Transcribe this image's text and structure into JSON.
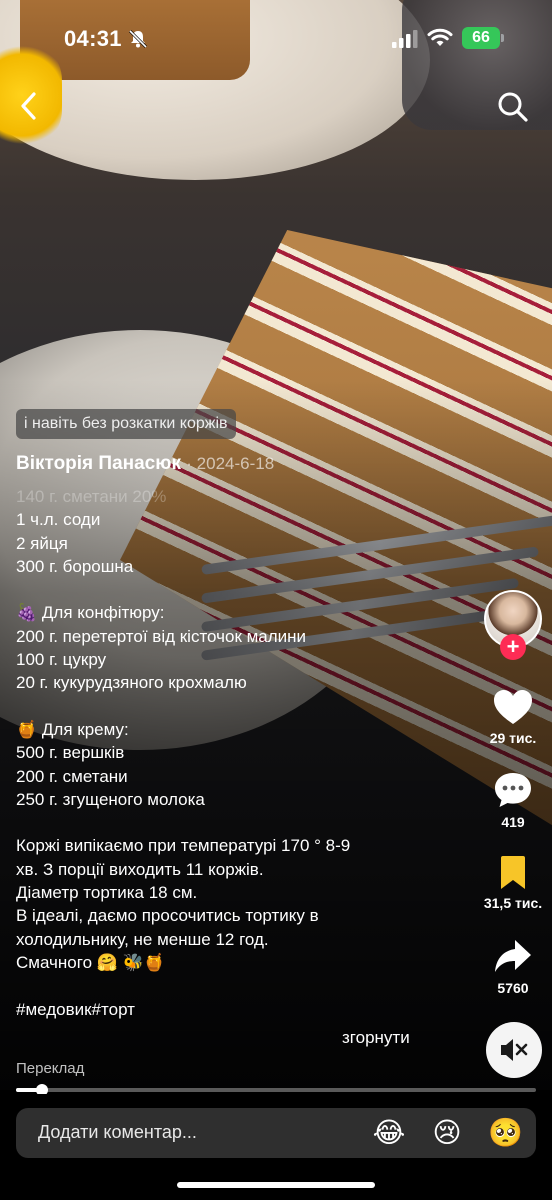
{
  "status_bar": {
    "time": "04:31",
    "battery": "66"
  },
  "caption": {
    "highlight_pill": "і навіть без розкатки коржів",
    "author": "Вікторія Панасюк",
    "date": "2024-6-18",
    "lines": [
      {
        "text": "140 г. сметани 20%",
        "faded": true
      },
      {
        "text": "1 ч.л. соди"
      },
      {
        "text": "2 яйця"
      },
      {
        "text": "300 г. борошна"
      },
      {
        "text": ""
      },
      {
        "text": "🍇 Для конфітюру:"
      },
      {
        "text": "200 г. перетертої від кісточок малини"
      },
      {
        "text": "100 г. цукру"
      },
      {
        "text": "20 г. кукурудзяного крохмалю"
      },
      {
        "text": ""
      },
      {
        "text": "🍯 Для крему:"
      },
      {
        "text": "500 г. вершків"
      },
      {
        "text": "200 г. сметани"
      },
      {
        "text": "250 г. згущеного молока"
      },
      {
        "text": ""
      },
      {
        "text": "Коржі випікаємо при температурі 170 ° 8-9"
      },
      {
        "text": "хв. З порції виходить 11 коржів."
      },
      {
        "text": "Діаметр тортика 18 см."
      },
      {
        "text": "В ідеалі, даємо просочитись тортику в"
      },
      {
        "text": "холодильнику, не менше 12 год."
      },
      {
        "text": "Смачного 🤗 🐝🍯"
      },
      {
        "text": ""
      },
      {
        "text": "#медовик#торт"
      }
    ],
    "collapse_label": "згорнути",
    "translate_label": "Переклад"
  },
  "actions": {
    "likes": "29 тис.",
    "comments": "419",
    "saves": "31,5 тис.",
    "shares": "5760"
  },
  "playback": {
    "progress": 0.05
  },
  "comment_bar": {
    "placeholder": "Додати коментар...",
    "emojis": [
      "😂",
      "😢",
      "🥺"
    ]
  },
  "colors": {
    "accent": "#fe2c55",
    "save": "#f7c528",
    "battery": "#35c759"
  }
}
